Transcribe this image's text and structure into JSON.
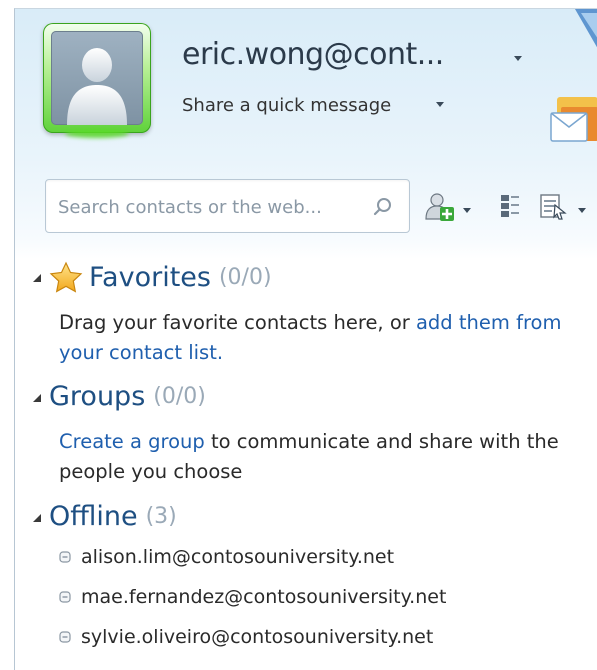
{
  "profile": {
    "user_name": "eric.wong@cont...",
    "quick_message": "Share a quick message"
  },
  "search": {
    "placeholder": "Search contacts or the web..."
  },
  "favorites": {
    "title": "Favorites",
    "count": "(0/0)",
    "text_before": "Drag your favorite contacts here, or ",
    "link": "add them from your contact list."
  },
  "groups": {
    "title": "Groups",
    "count": "(0/0)",
    "link": "Create a group",
    "text_after": " to communicate and share with the people you choose"
  },
  "offline": {
    "title": "Offline",
    "count": "(3)",
    "contacts": [
      "alison.lim@contosouniversity.net",
      "mae.fernandez@contosouniversity.net",
      "sylvie.oliveiro@contosouniversity.net"
    ]
  },
  "icons": {
    "avatar": "default-user-silhouette",
    "search": "magnifier-icon",
    "add_contact": "add-contact-icon",
    "layout": "layout-icon",
    "menu": "menu-icon",
    "favorites": "star-icon",
    "status": "offline-status-icon"
  },
  "colors": {
    "link": "#1f5fae",
    "section_title": "#1e4f82",
    "count": "#9aa9b7",
    "avatar_online": "#5fd23a"
  }
}
